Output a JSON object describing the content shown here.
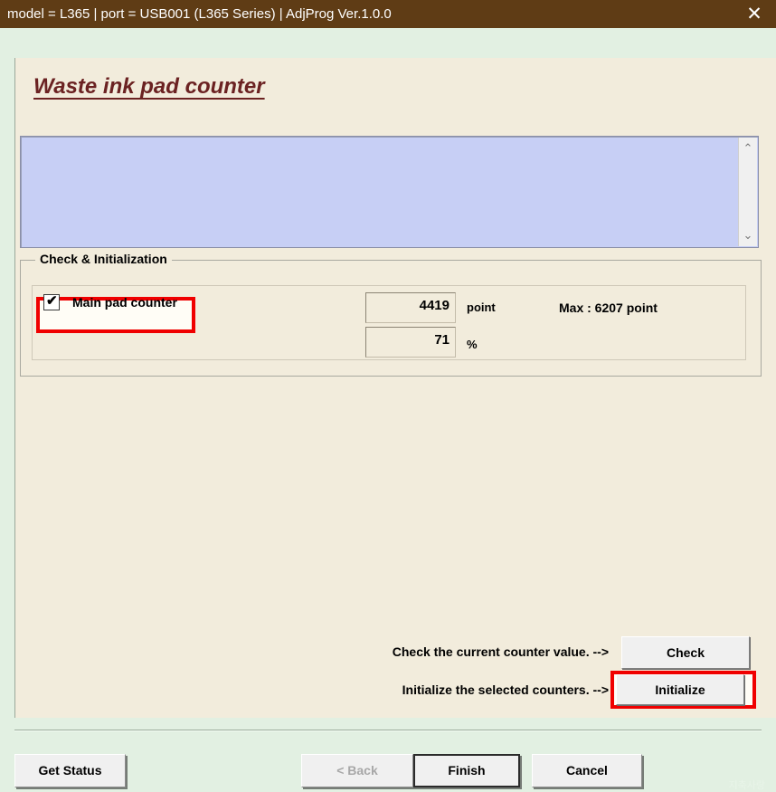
{
  "window": {
    "titlebar_text": "model = L365 | port = USB001 (L365 Series) | AdjProg Ver.1.0.0",
    "close_icon": "✕",
    "titlebar_color": "#5f3c15",
    "page_background": "#e2f0e2",
    "panel_background": "#f2ecdc"
  },
  "page": {
    "title": "Waste ink pad counter",
    "title_color": "#6b2222"
  },
  "log": {
    "text": "",
    "background": "#c7cff5",
    "scroll_up_icon": "⌃",
    "scroll_down_icon": "⌄"
  },
  "group": {
    "label": "Check & Initialization",
    "counter": {
      "checkbox_checked": true,
      "checkbox_icon": "✔",
      "label": "Main pad counter",
      "point_value": "4419",
      "point_unit": "point",
      "percent_value": "71",
      "percent_unit": "%",
      "max_text": "Max : 6207 point",
      "highlight_color": "#f00000"
    }
  },
  "actions": {
    "check_hint": "Check the current counter value. -->",
    "check_button": "Check",
    "initialize_hint": "Initialize the selected counters. -->",
    "initialize_button": "Initialize",
    "initialize_highlight_color": "#f00000"
  },
  "footer": {
    "get_status": "Get Status",
    "back": "< Back",
    "finish": "Finish",
    "cancel": "Cancel",
    "watermark": "지축사랑"
  }
}
